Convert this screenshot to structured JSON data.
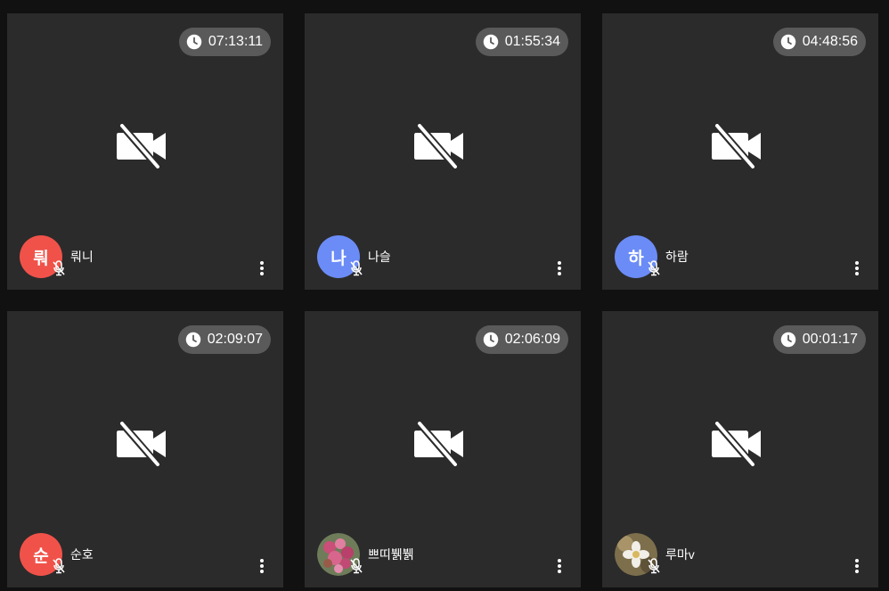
{
  "participants": [
    {
      "timer": "07:13:11",
      "initial": "뤄",
      "name": "뤄니",
      "avatar_color": "#f0524a",
      "avatar_type": "initial"
    },
    {
      "timer": "01:55:34",
      "initial": "나",
      "name": "나슬",
      "avatar_color": "#6b8cf7",
      "avatar_type": "initial"
    },
    {
      "timer": "04:48:56",
      "initial": "하",
      "name": "하람",
      "avatar_color": "#6b8cf7",
      "avatar_type": "initial"
    },
    {
      "timer": "02:09:07",
      "initial": "순",
      "name": "순호",
      "avatar_color": "#f0524a",
      "avatar_type": "initial"
    },
    {
      "timer": "02:06:09",
      "initial": "",
      "name": "쁘띠뷁뷁",
      "avatar_color": "#b84c6a",
      "avatar_type": "photo-pink-flowers"
    },
    {
      "timer": "00:01:17",
      "initial": "",
      "name": "루마v",
      "avatar_color": "#8a7a55",
      "avatar_type": "photo-white-flower"
    }
  ],
  "icons": {
    "timer": "clock-icon",
    "video": "video-off-icon",
    "audio": "mic-off-icon",
    "menu": "more-vert-icon"
  },
  "colors": {
    "background": "#111111",
    "tile": "#2b2b2b",
    "timer_pill": "#5a5a5a"
  }
}
